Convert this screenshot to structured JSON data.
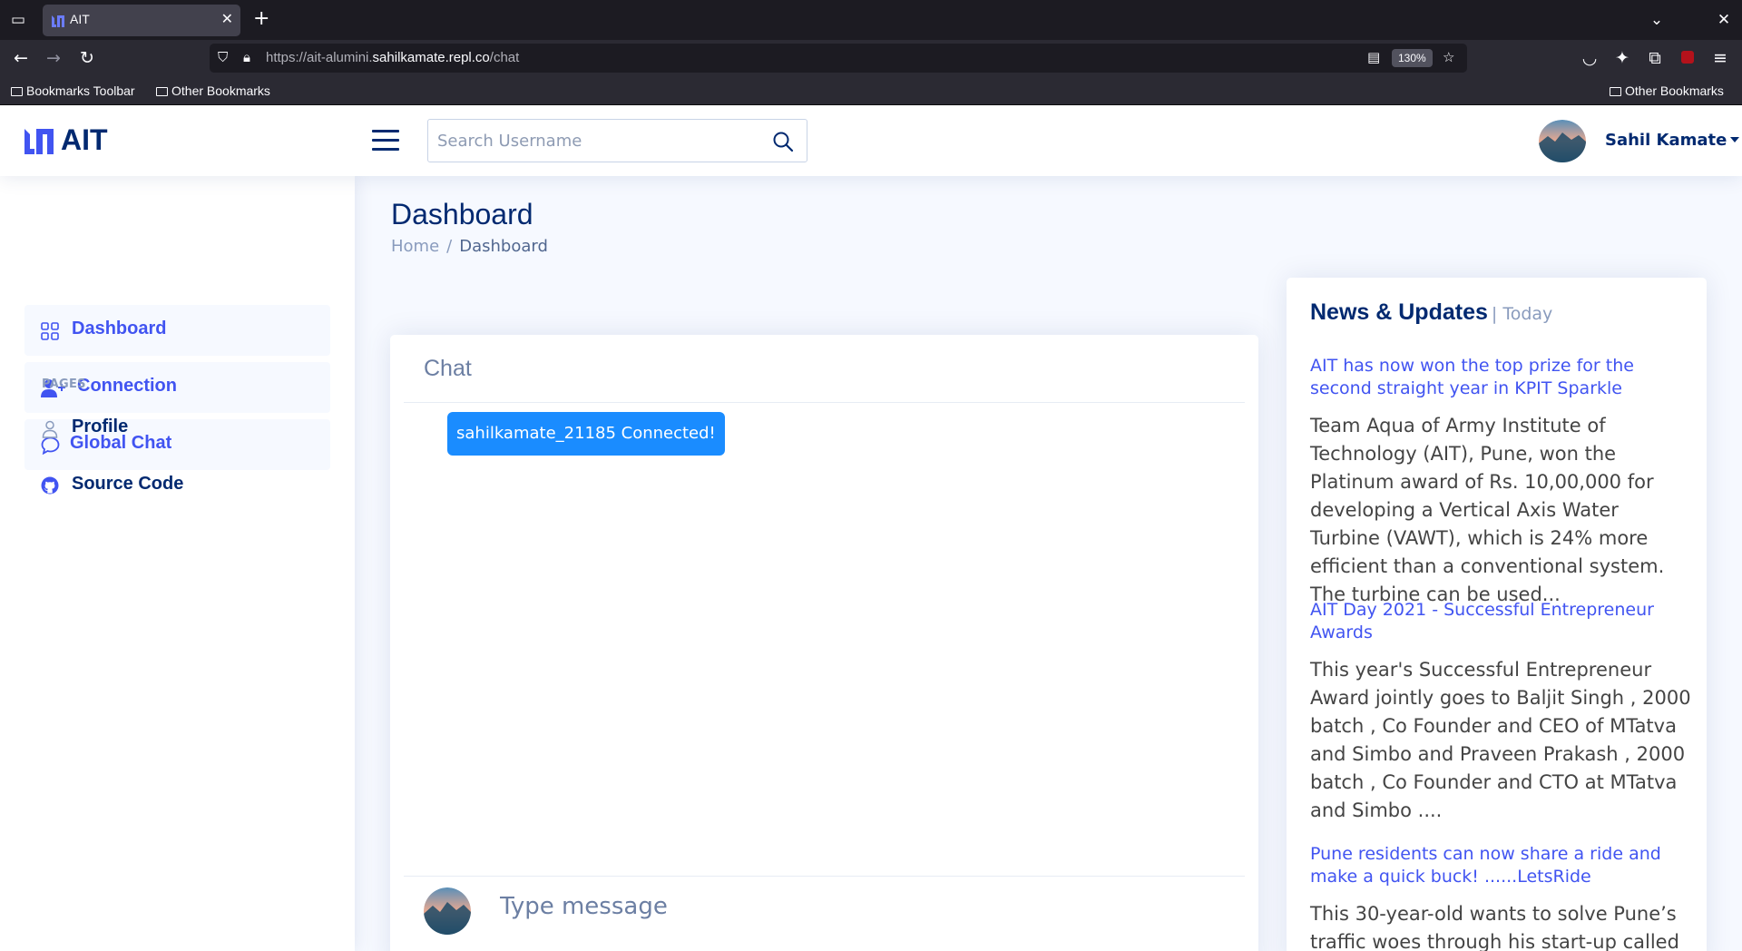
{
  "browser": {
    "tab_title": "AIT",
    "url_prefix": "https://ait-alumini.",
    "url_domain": "sahilkamate.repl.co",
    "url_path": "/chat",
    "zoom": "130%",
    "bookmarks_left": [
      "Bookmarks Toolbar",
      "Other Bookmarks"
    ],
    "bookmarks_right": "Other Bookmarks"
  },
  "header": {
    "logo_text": "AIT",
    "search_placeholder": "Search Username",
    "profile_name": "Sahil Kamate"
  },
  "sidebar": {
    "items": [
      {
        "label": "Dashboard",
        "icon": "grid-icon"
      },
      {
        "label": "Connection",
        "icon": "person-plus-icon"
      },
      {
        "label": "Global Chat",
        "icon": "chat-icon"
      }
    ],
    "heading": "PAGES",
    "pages": [
      {
        "label": "Profile",
        "icon": "person-icon"
      },
      {
        "label": "Source Code",
        "icon": "github-icon"
      }
    ]
  },
  "main": {
    "title": "Dashboard",
    "breadcrumb": [
      "Home",
      "Dashboard"
    ]
  },
  "chat": {
    "title": "Chat",
    "messages": [
      "sahilkamate_21185 Connected!"
    ],
    "input_placeholder": "Type message"
  },
  "news": {
    "title": "News & Updates",
    "subtitle": "| Today",
    "items": [
      {
        "title": "AIT has now won the top prize for the second straight year in KPIT Sparkle",
        "text": "Team Aqua of Army Institute of Technology (AIT), Pune, won the Platinum award of Rs. 10,00,000 for developing a Vertical Axis Water Turbine (VAWT), which is 24% more efficient than a conventional system. The turbine can be used..."
      },
      {
        "title": "AIT Day 2021 - Successful Entrepreneur Awards",
        "text": "This year's Successful Entrepreneur Award jointly goes to Baljit Singh , 2000 batch , Co Founder and CEO of MTatva and Simbo and Praveen Prakash , 2000 batch , Co Founder and CTO at MTatva and Simbo ...."
      },
      {
        "title": "Pune residents can now share a ride and make a quick buck! ......LetsRide",
        "text": "This 30-year-old wants to solve Pune’s traffic woes through his start-up called"
      }
    ]
  },
  "colors": {
    "accent": "#4154f1",
    "navy": "#012970",
    "bubble": "#1a8cff"
  }
}
